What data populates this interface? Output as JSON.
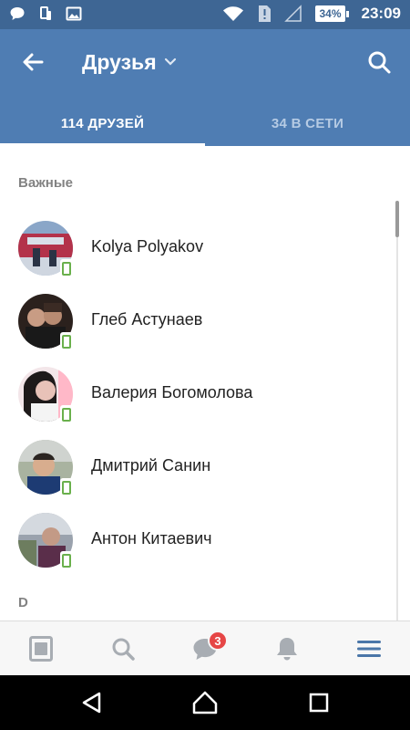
{
  "status_bar": {
    "time": "23:09",
    "battery_percent": "34%"
  },
  "header": {
    "title": "Друзья"
  },
  "tabs": [
    {
      "label": "114 ДРУЗЕЙ",
      "active": true
    },
    {
      "label": "34 В СЕТИ",
      "active": false
    }
  ],
  "sections": [
    {
      "header": "Важные"
    },
    {
      "header": "D"
    }
  ],
  "friends": [
    {
      "name": "Kolya Polyakov",
      "online_mobile": true
    },
    {
      "name": "Глеб Астунаев",
      "online_mobile": true
    },
    {
      "name": "Валерия Богомолова",
      "online_mobile": true
    },
    {
      "name": "Дмитрий Санин",
      "online_mobile": true
    },
    {
      "name": "Антон Китаевич",
      "online_mobile": true
    }
  ],
  "bottom_nav": {
    "messages_badge": "3",
    "items": [
      "news-icon",
      "search-icon",
      "messages-icon",
      "notifications-icon",
      "menu-icon"
    ]
  },
  "colors": {
    "header_bg": "#4f7db3",
    "status_bg": "#3e6694",
    "accent": "#4a76a8",
    "online_green": "#6ab04c",
    "badge_red": "#e64646"
  }
}
